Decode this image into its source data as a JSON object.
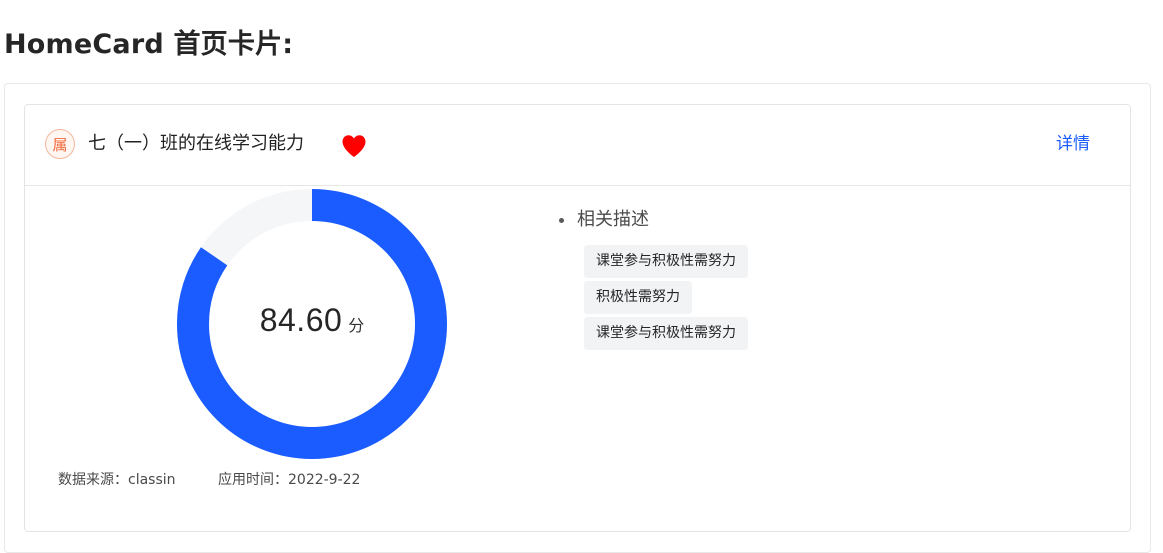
{
  "page": {
    "heading": "HomeCard 首页卡片:"
  },
  "card": {
    "badge_text": "属",
    "title": "七（一）班的在线学习能力",
    "heart_icon": "heart-icon",
    "heart_color": "#ff0000",
    "detail_label": "详情",
    "score": {
      "value": "84.60",
      "unit": "分",
      "percent": 84.6,
      "ring_color": "#1a5cff",
      "track_color": "#f4f6f8"
    },
    "source_text": "数据来源：classin",
    "time_text": "应用时间：2022-9-22",
    "description": {
      "heading": "相关描述",
      "tags": [
        "课堂参与积极性需努力",
        "积极性需努力",
        "课堂参与积极性需努力"
      ]
    }
  }
}
